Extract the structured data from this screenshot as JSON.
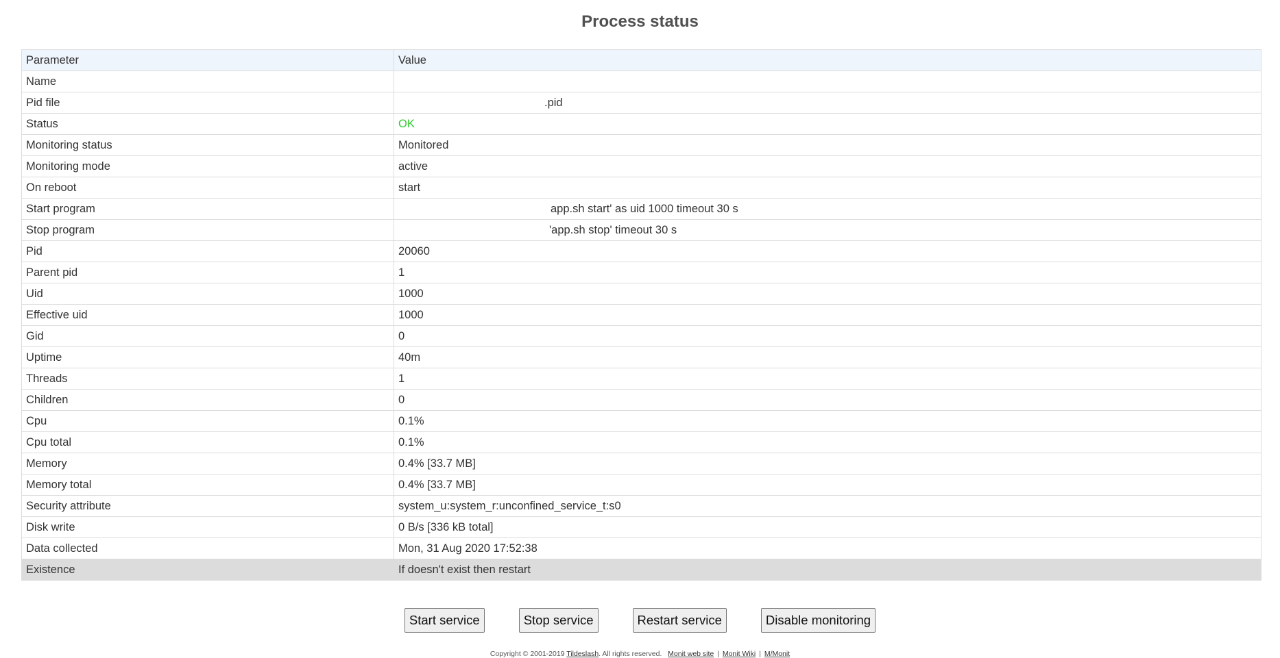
{
  "title": "Process status",
  "table": {
    "headers": [
      "Parameter",
      "Value"
    ],
    "rows": [
      {
        "param": "Name",
        "value": ""
      },
      {
        "param": "Pid file",
        "value": ".pid"
      },
      {
        "param": "Status",
        "value": "OK"
      },
      {
        "param": "Monitoring status",
        "value": "Monitored"
      },
      {
        "param": "Monitoring mode",
        "value": "active"
      },
      {
        "param": "On reboot",
        "value": "start"
      },
      {
        "param": "Start program",
        "value": "app.sh start' as uid 1000 timeout 30 s"
      },
      {
        "param": "Stop program",
        "value": "'app.sh stop' timeout 30 s"
      },
      {
        "param": "Pid",
        "value": "20060"
      },
      {
        "param": "Parent pid",
        "value": "1"
      },
      {
        "param": "Uid",
        "value": "1000"
      },
      {
        "param": "Effective uid",
        "value": "1000"
      },
      {
        "param": "Gid",
        "value": "0"
      },
      {
        "param": "Uptime",
        "value": "40m"
      },
      {
        "param": "Threads",
        "value": "1"
      },
      {
        "param": "Children",
        "value": "0"
      },
      {
        "param": "Cpu",
        "value": "0.1%"
      },
      {
        "param": "Cpu total",
        "value": "0.1%"
      },
      {
        "param": "Memory",
        "value": "0.4% [33.7 MB]"
      },
      {
        "param": "Memory total",
        "value": "0.4% [33.7 MB]"
      },
      {
        "param": "Security attribute",
        "value": "system_u:system_r:unconfined_service_t:s0"
      },
      {
        "param": "Disk write",
        "value": "0 B/s [336 kB total]"
      },
      {
        "param": "Data collected",
        "value": "Mon, 31 Aug 2020 17:52:38"
      },
      {
        "param": "Existence",
        "value": "If doesn't exist then restart"
      }
    ]
  },
  "buttons": {
    "start": "Start service",
    "stop": "Stop service",
    "restart": "Restart service",
    "disable": "Disable monitoring"
  },
  "footer": {
    "copyright": "Copyright © 2001-2019",
    "company": "Tildeslash",
    "rights": ". All rights reserved.",
    "website": "Monit web site",
    "wiki": "Monit Wiki",
    "mmonit": "M/Monit",
    "separator": "|"
  },
  "colors": {
    "status_ok": "#2ecc2e",
    "header_bg": "#eef5fd",
    "existence_bg": "#dcdcdc"
  }
}
